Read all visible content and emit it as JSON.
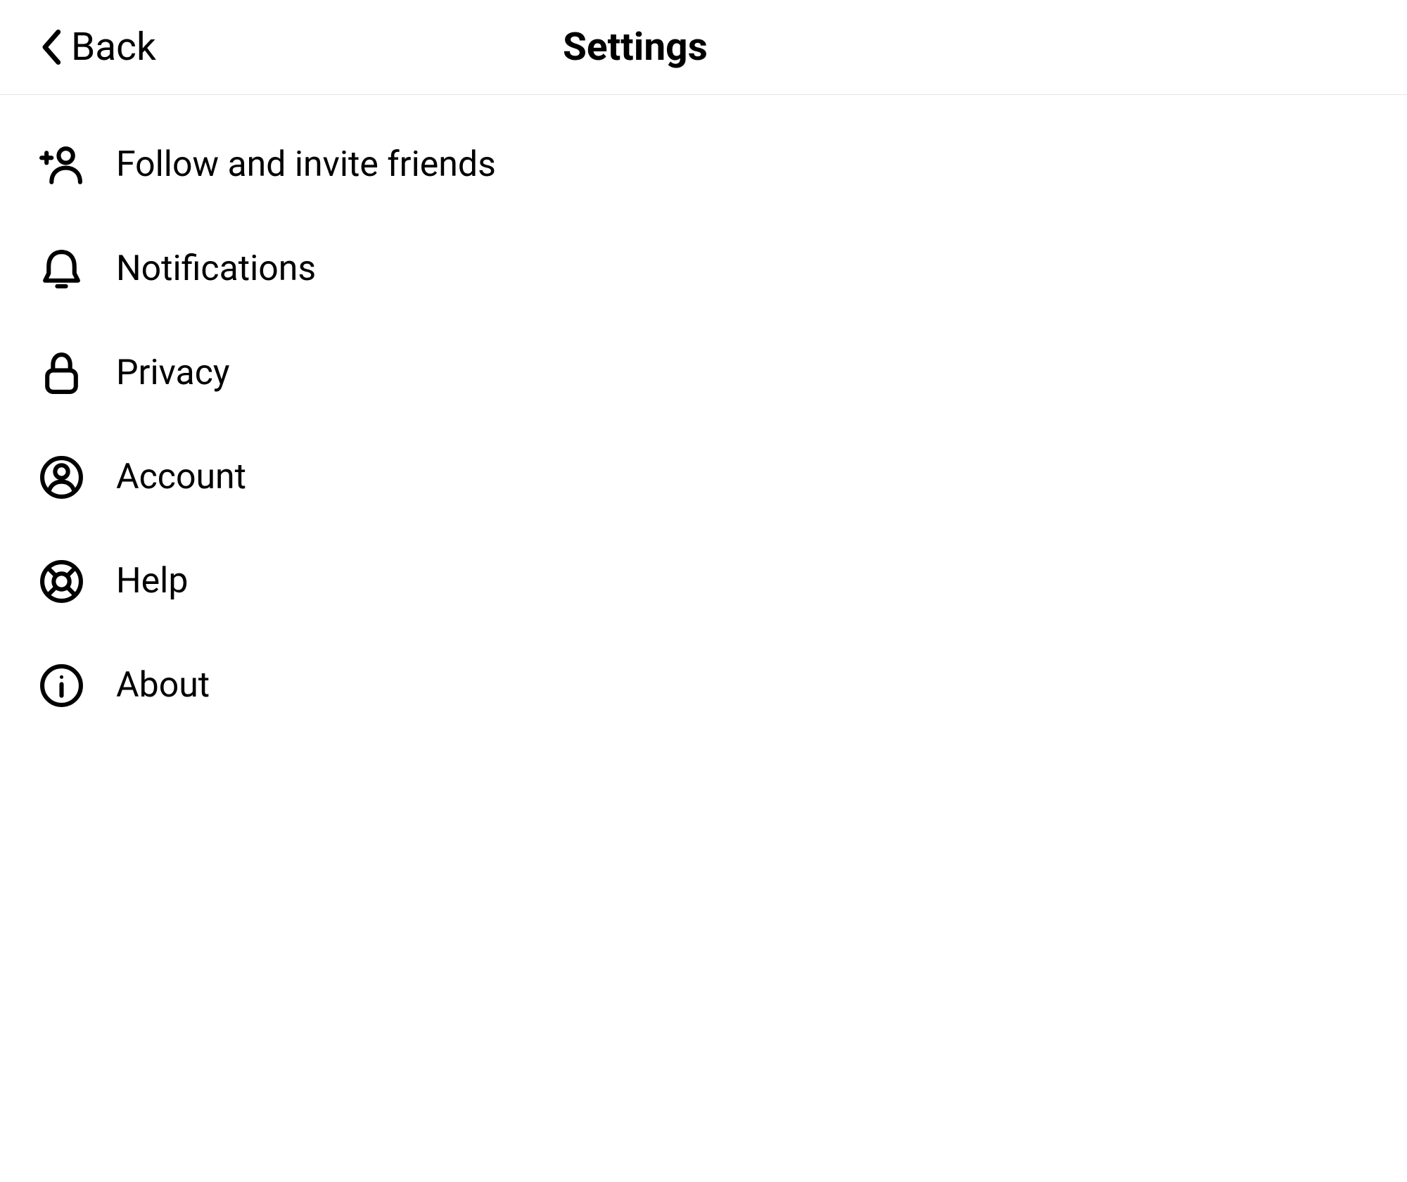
{
  "header": {
    "back_label": "Back",
    "title": "Settings"
  },
  "settings": {
    "items": [
      {
        "icon": "person-plus-icon",
        "label": "Follow and invite friends"
      },
      {
        "icon": "bell-icon",
        "label": "Notifications"
      },
      {
        "icon": "lock-icon",
        "label": "Privacy"
      },
      {
        "icon": "account-circle-icon",
        "label": "Account"
      },
      {
        "icon": "lifebuoy-icon",
        "label": "Help"
      },
      {
        "icon": "info-icon",
        "label": "About"
      }
    ]
  }
}
